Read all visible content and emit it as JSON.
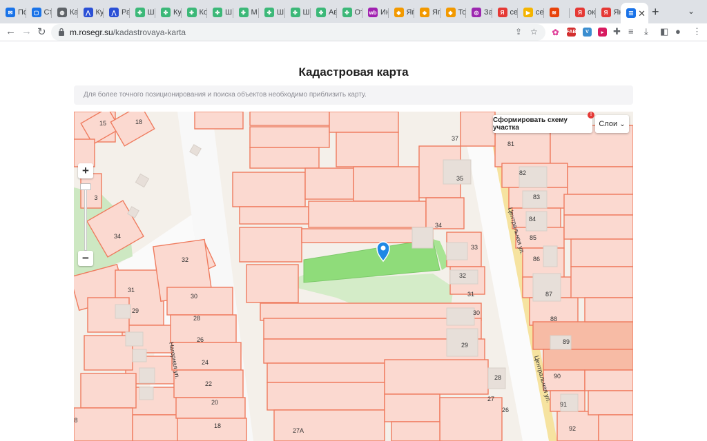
{
  "browser": {
    "tabs": [
      {
        "label": "По",
        "color": "#1a73e8",
        "glyph": "✉"
      },
      {
        "label": "Ст",
        "color": "#1a73e8",
        "glyph": "▢"
      },
      {
        "label": "Ка",
        "color": "#5f6368",
        "glyph": "◍"
      },
      {
        "label": "Ку",
        "color": "#2b50d6",
        "glyph": "⋀"
      },
      {
        "label": "Ра",
        "color": "#2b50d6",
        "glyph": "⋀"
      },
      {
        "label": "Ш",
        "color": "#3cb878",
        "glyph": "✤"
      },
      {
        "label": "Ку",
        "color": "#3cb878",
        "glyph": "✤"
      },
      {
        "label": "Ко",
        "color": "#3cb878",
        "glyph": "✤"
      },
      {
        "label": "Ш",
        "color": "#3cb878",
        "glyph": "✤"
      },
      {
        "label": "М",
        "color": "#3cb878",
        "glyph": "✤"
      },
      {
        "label": "Ш",
        "color": "#3cb878",
        "glyph": "✤"
      },
      {
        "label": "Ш",
        "color": "#3cb878",
        "glyph": "✤"
      },
      {
        "label": "Ав",
        "color": "#3cb878",
        "glyph": "✤"
      },
      {
        "label": "От",
        "color": "#3cb878",
        "glyph": "✤"
      },
      {
        "label": "Ин",
        "color": "#a020b0",
        "glyph": "wb"
      },
      {
        "label": "Яг",
        "color": "#f29900",
        "glyph": "◆"
      },
      {
        "label": "Яг",
        "color": "#f29900",
        "glyph": "◆"
      },
      {
        "label": "То",
        "color": "#f29900",
        "glyph": "◆"
      },
      {
        "label": "За",
        "color": "#9c27b0",
        "glyph": "◎"
      },
      {
        "label": "се",
        "color": "#e53935",
        "glyph": "Я"
      },
      {
        "label": "се",
        "color": "#f4b400",
        "glyph": "▶"
      },
      {
        "label": "",
        "color": "#e8430a",
        "glyph": "≋"
      },
      {
        "label": "ок",
        "color": "#e53935",
        "glyph": "Я"
      },
      {
        "label": "Ян",
        "color": "#e53935",
        "glyph": "Я"
      }
    ],
    "active_tab_glyph": "☰",
    "url_host": "m.rosegr.su",
    "url_path": "/kadastrovaya-karta"
  },
  "page": {
    "title": "Кадастровая карта",
    "notice": "Для более точного позиционирования и поиска объектов необходимо приблизить карту."
  },
  "map": {
    "zoom_in": "+",
    "zoom_out": "−",
    "scheme_button": "Сформировать схему участка",
    "badge": "!",
    "layers_button": "Слои",
    "streets": {
      "nagornaya": "Нагорная ул.",
      "central_1": "Центральная ул.",
      "central_2": "Центральная ул."
    },
    "parcel_numbers": [
      "15",
      "18",
      "37",
      "81",
      "82",
      "35",
      "83",
      "3",
      "34",
      "84",
      "34",
      "85",
      "33",
      "32",
      "86",
      "32",
      "31",
      "87",
      "30",
      "31",
      "29",
      "88",
      "30",
      "28",
      "89",
      "29",
      "26",
      "24",
      "28",
      "90",
      "22",
      "27",
      "20",
      "26",
      "91",
      "18",
      "27А",
      "92",
      "8"
    ]
  }
}
